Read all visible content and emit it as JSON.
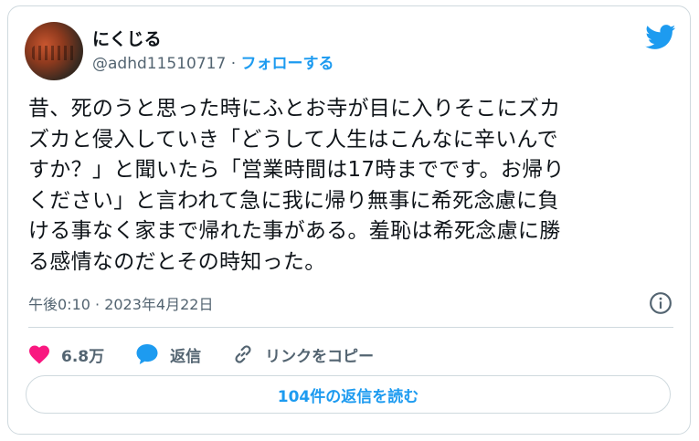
{
  "author": {
    "display_name": "にくじる",
    "handle": "@adhd11510717",
    "separator": "·",
    "follow_label": "フォローする"
  },
  "tweet": {
    "text": "昔、死のうと思った時にふとお寺が目に入りそこにズカ\nズカと侵入していき「どうして人生はこんなに辛いんで\nすか？」と聞いたら「営業時間は17時までです。お帰り\nください」と言われて急に我に帰り無事に希死念慮に負\nける事なく家まで帰れた事がある。羞恥は希死念慮に勝\nる感情なのだとその時知った。",
    "timestamp": "午後0:10 · 2023年4月22日"
  },
  "actions": {
    "like_count": "6.8万",
    "reply_label": "返信",
    "copy_link_label": "リンクをコピー"
  },
  "read_replies_label": "104件の返信を読む",
  "icons": {
    "brand": "twitter-bird-icon",
    "info": "info-icon",
    "like": "heart-icon",
    "reply": "speech-bubble-icon",
    "copy_link": "link-icon"
  },
  "colors": {
    "accent": "#1d9bf0",
    "like": "#f91880",
    "muted_text": "#536471",
    "border": "#cfd9de"
  }
}
